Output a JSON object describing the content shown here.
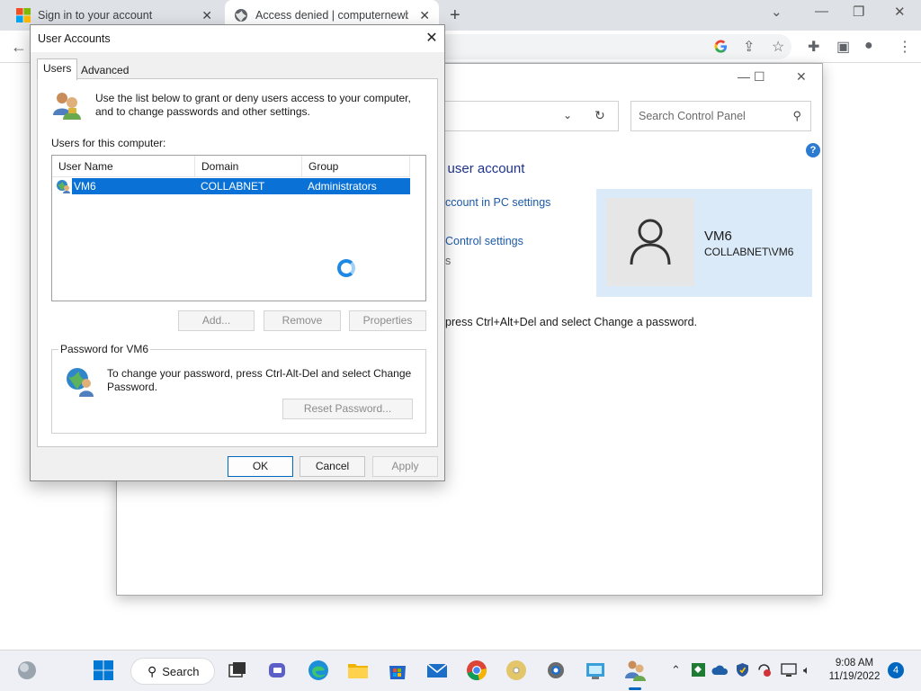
{
  "browser": {
    "tabs": [
      {
        "title": "Sign in to your account"
      },
      {
        "title": "Access denied | computernewb.c"
      }
    ]
  },
  "control_panel": {
    "search_placeholder": "Search Control Panel",
    "heading": "ur user account",
    "links": [
      "ccount in PC settings",
      "Control settings",
      "s"
    ],
    "password_hint": "press Ctrl+Alt+Del and select Change a password.",
    "user": {
      "name": "VM6",
      "domain_user": "COLLABNET\\VM6"
    }
  },
  "dialog": {
    "title": "User Accounts",
    "tabs": [
      {
        "label": "Users",
        "active": true
      },
      {
        "label": "Advanced",
        "active": false
      }
    ],
    "intro": "Use the list below to grant or deny users access to your computer, and to change passwords and other settings.",
    "users_label": "Users for this computer:",
    "columns": [
      "User Name",
      "Domain",
      "Group"
    ],
    "rows": [
      {
        "user": "VM6",
        "domain": "COLLABNET",
        "group": "Administrators",
        "selected": true
      }
    ],
    "buttons": {
      "add": "Add...",
      "remove": "Remove",
      "properties": "Properties"
    },
    "password_group": {
      "legend": "Password for VM6",
      "text": "To change your password, press Ctrl-Alt-Del and select Change Password.",
      "reset_button": "Reset Password..."
    },
    "footer": {
      "ok": "OK",
      "cancel": "Cancel",
      "apply": "Apply"
    }
  },
  "taskbar": {
    "search_label": "Search",
    "time": "9:08 AM",
    "date": "11/19/2022",
    "notification_count": "4"
  },
  "colors": {
    "selection": "#0a72d6",
    "accent": "#0067c0",
    "link": "#1d5aa8",
    "heading": "#1e3287",
    "user_card": "#dbeaf8"
  }
}
